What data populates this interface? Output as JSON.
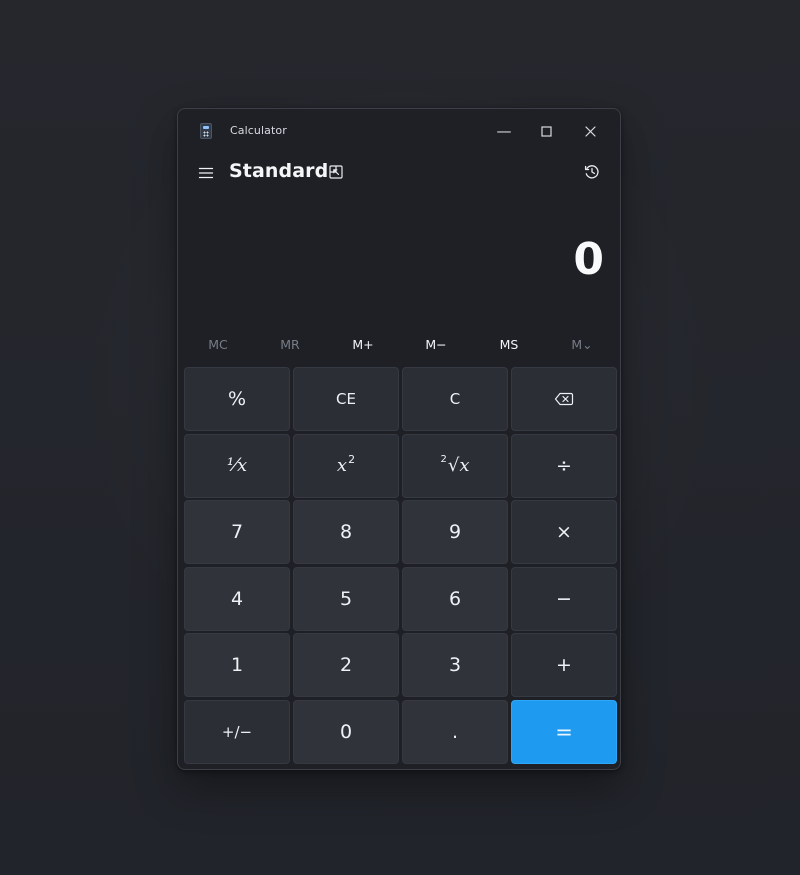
{
  "window": {
    "title": "Calculator"
  },
  "header": {
    "mode_title": "Standard"
  },
  "display": {
    "value": "0"
  },
  "memory": {
    "mc": "MC",
    "mr": "MR",
    "mplus": "M+",
    "mminus": "M−",
    "ms": "MS",
    "mlist": "M⌄"
  },
  "keys": {
    "percent": "%",
    "ce": "CE",
    "clear": "C",
    "reciprocal": "¹⁄x",
    "square_base": "x",
    "square_exp": "2",
    "root_index": "2",
    "root_symbol": "√x",
    "divide": "÷",
    "seven": "7",
    "eight": "8",
    "nine": "9",
    "multiply": "×",
    "four": "4",
    "five": "5",
    "six": "6",
    "minus": "−",
    "one": "1",
    "two": "2",
    "three": "3",
    "plus": "+",
    "negate": "+/−",
    "zero": "0",
    "decimal": ".",
    "equals": "="
  },
  "icons": {
    "app": "calculator-icon",
    "menu": "menu-icon",
    "keep_on_top": "keep-on-top-icon",
    "history": "history-icon",
    "minimize": "minimize-icon",
    "maximize": "maximize-icon",
    "close": "close-icon",
    "backspace": "backspace-icon"
  },
  "colors": {
    "background": "#23252a",
    "window": "#1e2026",
    "key": "#2d3037",
    "equals": "#1e9bf0",
    "text": "#eef1f5",
    "disabled_text": "#777c86"
  }
}
